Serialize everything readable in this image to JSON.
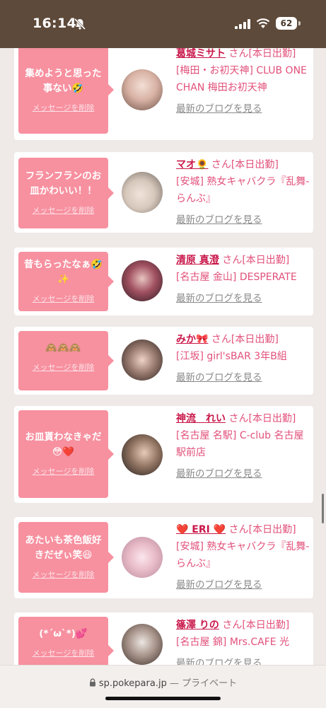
{
  "status": {
    "time": "16:14",
    "battery": "62"
  },
  "messages": [
    {
      "text": "集めようと思った事ない🤣",
      "delete": "メッセージを削除",
      "name": "葛城ミサト",
      "suffix": " さん[本日出勤]",
      "shop": "[梅田・お初天神] CLUB ONE CHAN 梅田お初天神",
      "blog": "最新のブログを見る",
      "avatar_color": "#c7a49b"
    },
    {
      "text": "フランフランのお皿かわいい！！",
      "delete": "メッセージを削除",
      "name": "マオ🌻",
      "suffix": " さん[本日出勤]",
      "shop": "[安城] 熟女キャバクラ『乱舞-らんぶ』",
      "blog": "最新のブログを見る",
      "avatar_color": "#d9cfc6"
    },
    {
      "text": "昔もらったなぁ🤣✨",
      "delete": "メッセージを削除",
      "name": "清原 真澄",
      "suffix": " さん[本日出勤]",
      "shop": "[名古屋 金山] DESPERATE",
      "blog": "最新のブログを見る",
      "avatar_color": "#7a3040"
    },
    {
      "text": "🙈🙈🙈",
      "delete": "メッセージを削除",
      "name": "みか🎀",
      "suffix": " さん[本日出勤]",
      "shop": "[江坂] girl'sBAR 3年B組",
      "blog": "最新のブログを見る",
      "avatar_color": "#5a4a44"
    },
    {
      "text": "お皿貰わなきゃだ😳❤️",
      "delete": "メッセージを削除",
      "name": "神流　れい",
      "suffix": " さん[本日出勤]",
      "shop": "[名古屋 名駅] C-club 名古屋駅前店",
      "blog": "最新のブログを見る",
      "avatar_color": "#3e3b3a"
    },
    {
      "text": "あたいも茶色飯好きだぜぃ笑😆",
      "delete": "メッセージを削除",
      "name": "❤️ ERI ❤️",
      "suffix": " さん[本日出勤]",
      "shop": "[安城] 熟女キャバクラ『乱舞-らんぶ』",
      "blog": "最新のブログを見る",
      "avatar_color": "#e6bcc8"
    },
    {
      "text": "(*´ω`*)💕",
      "delete": "メッセージを削除",
      "name": "篠澤 りの",
      "suffix": " さん[本日出勤]",
      "shop": "[名古屋 錦] Mrs.CAFE 光",
      "blog": "最新のブログを見る",
      "avatar_color": "#8c7466"
    }
  ],
  "browser": {
    "url": "sp.pokepara.jp",
    "mode": "プライベート"
  }
}
